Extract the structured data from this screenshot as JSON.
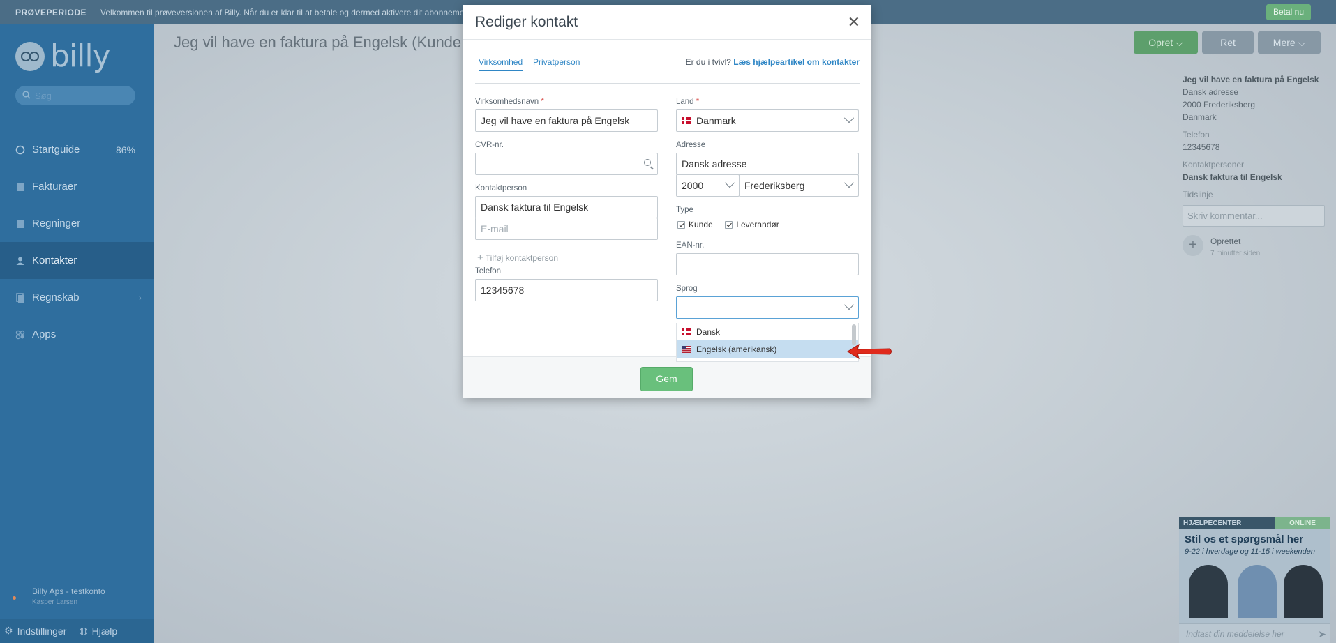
{
  "topbar": {
    "label": "PRØVEPERIODE",
    "message": "Velkommen til prøveversionen af Billy. Når du er klar til at betale og dermed aktivere dit abonnement.",
    "pay_button": "Betal nu"
  },
  "sidebar": {
    "logo_text": "billy",
    "search_placeholder": "Søg",
    "items": [
      {
        "label": "Startguide",
        "icon": "circle-progress-icon",
        "extra": "86%"
      },
      {
        "label": "Fakturaer",
        "icon": "invoice-icon"
      },
      {
        "label": "Regninger",
        "icon": "bill-icon"
      },
      {
        "label": "Kontakter",
        "icon": "contact-icon",
        "active": true
      },
      {
        "label": "Regnskab",
        "icon": "ledger-icon"
      },
      {
        "label": "Apps",
        "icon": "apps-icon"
      }
    ],
    "account_name": "Billy Aps - testkonto",
    "account_user": "Kasper Larsen",
    "settings_label": "Indstillinger",
    "help_label": "Hjælp"
  },
  "main": {
    "title": "Jeg vil have en faktura på Engelsk (Kunde & Leverandør)",
    "buttons": {
      "create": "Opret",
      "edit": "Ret",
      "more": "Mere"
    }
  },
  "right_panel": {
    "name": "Jeg vil have en faktura på Engelsk",
    "address1": "Dansk adresse",
    "address2": "2000 Frederiksberg",
    "country": "Danmark",
    "phone_label": "Telefon",
    "phone": "12345678",
    "contacts_label": "Kontaktpersoner",
    "contact": "Dansk faktura til Engelsk",
    "timeline_label": "Tidslinje",
    "comment_placeholder": "Skriv kommentar...",
    "activity_title": "Oprettet",
    "activity_time": "7 minutter siden"
  },
  "help_widget": {
    "label": "HJÆLPECENTER",
    "status": "ONLINE",
    "title": "Stil os et spørgsmål her",
    "subtitle": "9-22 i hverdage og 11-15 i weekenden",
    "input_placeholder": "Indtast din meddelelse her"
  },
  "modal": {
    "title": "Rediger kontakt",
    "tabs": [
      "Virksomhed",
      "Privatperson"
    ],
    "help_text": "Er du i tvivl?",
    "help_link": "Læs hjælpeartikel om kontakter",
    "company_name_label": "Virksomhedsnavn",
    "company_name_value": "Jeg vil have en faktura på Engelsk",
    "cvr_label": "CVR-nr.",
    "cvr_value": "",
    "contact_person_label": "Kontaktperson",
    "contact_person_value": "Dansk faktura til Engelsk",
    "email_placeholder": "E-mail",
    "add_contact_label": "Tilføj kontaktperson",
    "phone_label": "Telefon",
    "phone_value": "12345678",
    "country_label": "Land",
    "country_value": "Danmark",
    "address_label": "Adresse",
    "address_value": "Dansk adresse",
    "zip_value": "2000",
    "city_value": "Frederiksberg",
    "type_label": "Type",
    "type_customer": "Kunde",
    "type_supplier": "Leverandør",
    "ean_label": "EAN-nr.",
    "ean_value": "",
    "language_label": "Sprog",
    "language_value": "",
    "language_options": [
      "Dansk",
      "Engelsk (amerikansk)"
    ],
    "save_label": "Gem"
  },
  "colors": {
    "sidebar": "#2f6e9e",
    "accent_link": "#2f86c5",
    "save_button": "#69c07c",
    "highlight_option": "#c5ddf0",
    "annotation_arrow": "#e02a1c"
  }
}
